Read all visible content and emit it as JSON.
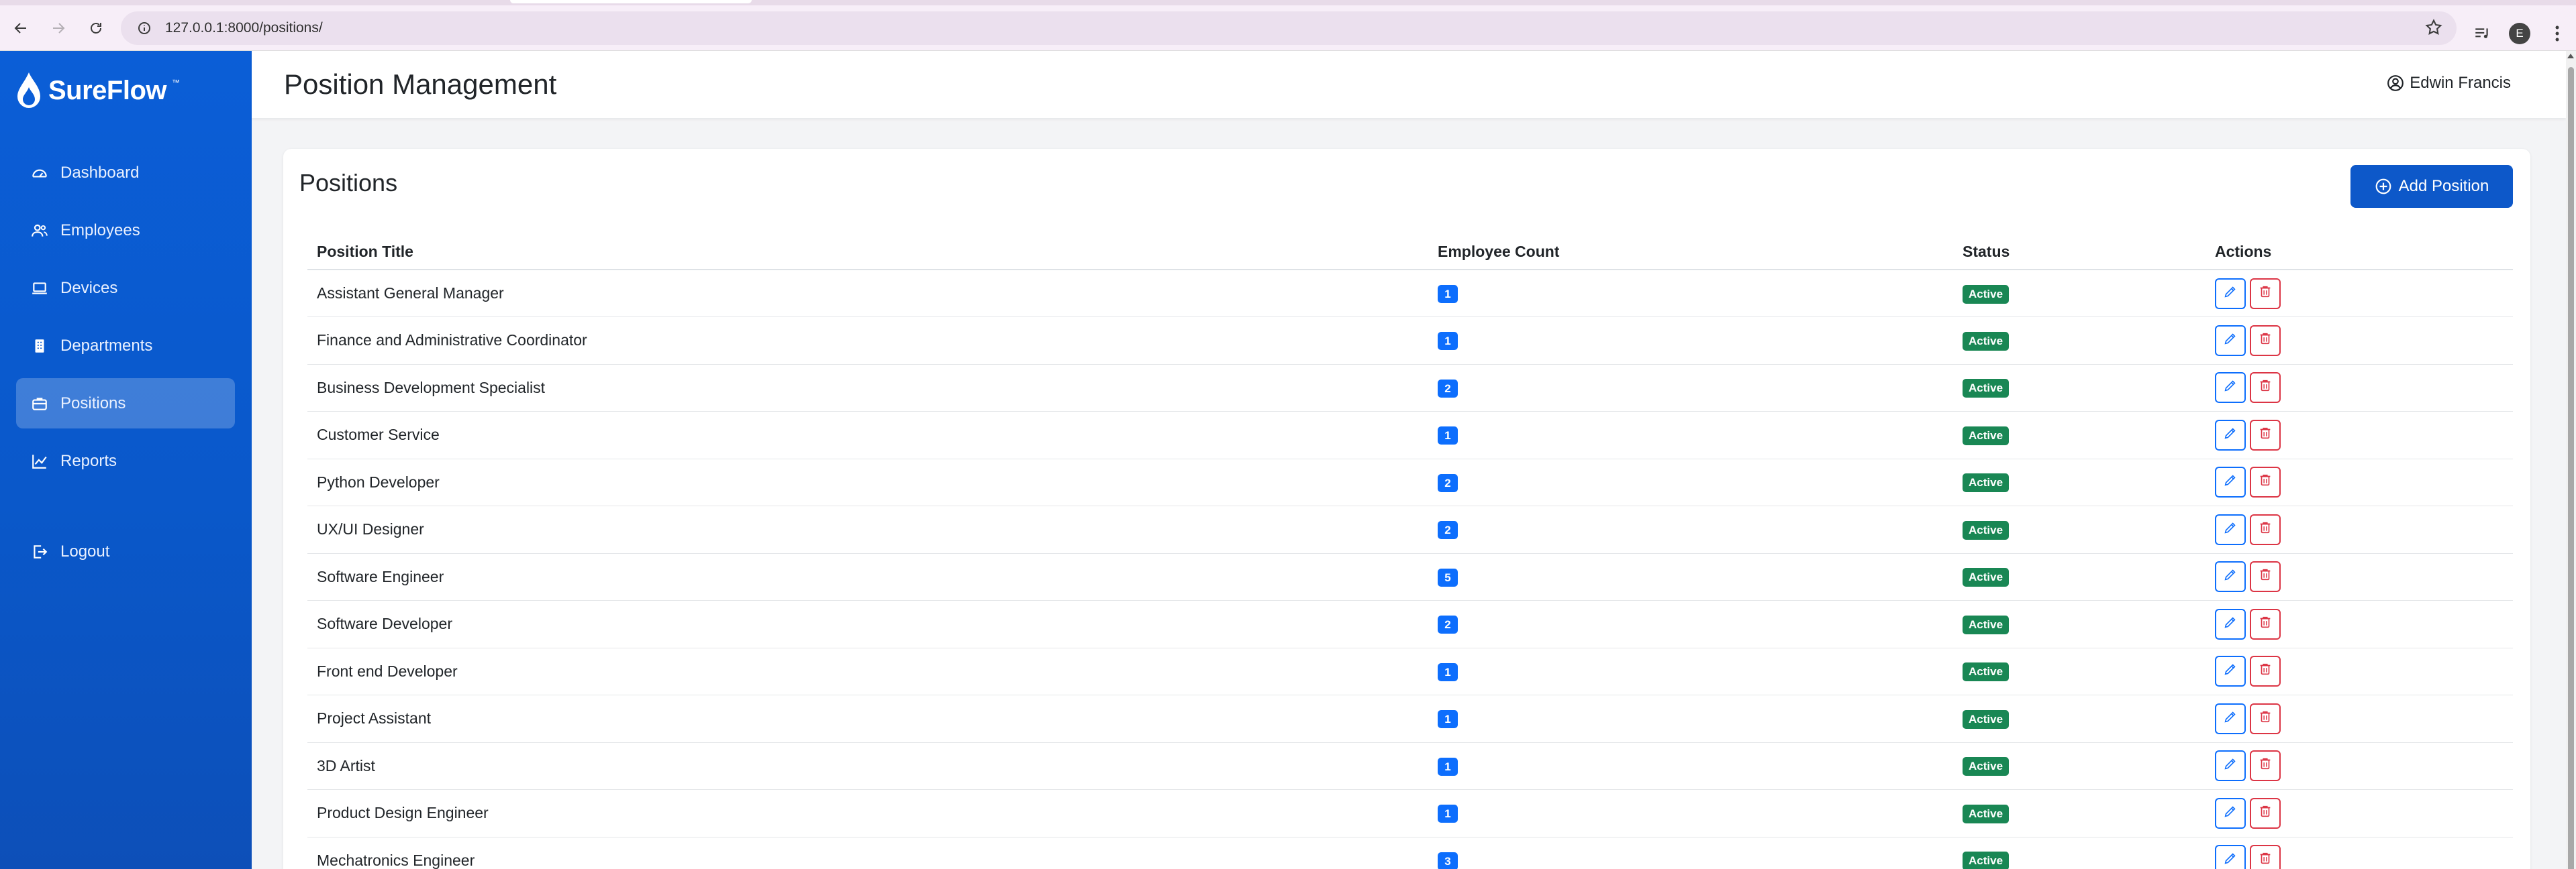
{
  "browser": {
    "url": "127.0.0.1:8000/positions/",
    "profile_initial": "E"
  },
  "sidebar": {
    "brand": "SureFlow",
    "brand_mark": "™",
    "items": [
      {
        "label": "Dashboard",
        "icon": "dashboard-gauge-icon"
      },
      {
        "label": "Employees",
        "icon": "people-icon"
      },
      {
        "label": "Devices",
        "icon": "laptop-icon"
      },
      {
        "label": "Departments",
        "icon": "building-icon"
      },
      {
        "label": "Positions",
        "icon": "briefcase-icon",
        "active": true
      },
      {
        "label": "Reports",
        "icon": "chart-line-icon"
      }
    ],
    "logout_label": "Logout"
  },
  "header": {
    "title": "Position Management",
    "user_name": "Edwin Francis"
  },
  "card": {
    "title": "Positions",
    "add_button": "Add Position"
  },
  "table": {
    "headers": [
      "Position Title",
      "Employee Count",
      "Status",
      "Actions"
    ],
    "rows": [
      {
        "title": "Assistant General Manager",
        "count": "1",
        "status": "Active"
      },
      {
        "title": "Finance and Administrative Coordinator",
        "count": "1",
        "status": "Active"
      },
      {
        "title": "Business Development Specialist",
        "count": "2",
        "status": "Active"
      },
      {
        "title": "Customer Service",
        "count": "1",
        "status": "Active"
      },
      {
        "title": "Python Developer",
        "count": "2",
        "status": "Active"
      },
      {
        "title": "UX/UI Designer",
        "count": "2",
        "status": "Active"
      },
      {
        "title": "Software Engineer",
        "count": "5",
        "status": "Active"
      },
      {
        "title": "Software Developer",
        "count": "2",
        "status": "Active"
      },
      {
        "title": "Front end Developer",
        "count": "1",
        "status": "Active"
      },
      {
        "title": "Project Assistant",
        "count": "1",
        "status": "Active"
      },
      {
        "title": "3D Artist",
        "count": "1",
        "status": "Active"
      },
      {
        "title": "Product Design Engineer",
        "count": "1",
        "status": "Active"
      },
      {
        "title": "Mechatronics Engineer",
        "count": "3",
        "status": "Active"
      }
    ]
  },
  "colors": {
    "sidebar": "#0b5ed7",
    "primary": "#0d6efd",
    "success": "#198754",
    "danger": "#dc3545"
  }
}
